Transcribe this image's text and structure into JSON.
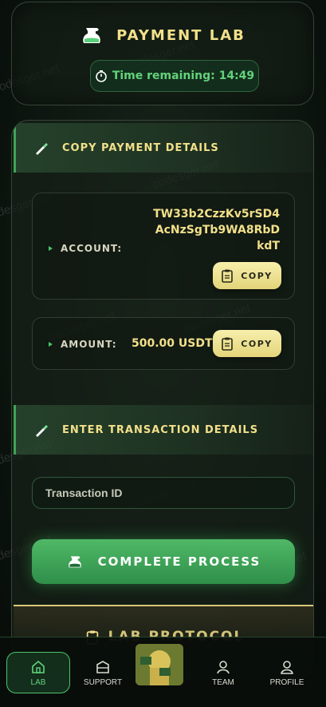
{
  "header": {
    "title": "PAYMENT LAB",
    "timer_text": "Time remaining: 14:49"
  },
  "copy_section": {
    "title": "COPY PAYMENT DETAILS",
    "account_label": "ACCOUNT:",
    "account_value": "TW33b2CzzKv5rSD4AcNzSgTb9WA8RbDkdT",
    "amount_label": "AMOUNT:",
    "amount_value": "500.00 USDT",
    "copy_label": "COPY"
  },
  "transaction_section": {
    "title": "ENTER TRANSACTION DETAILS",
    "input_placeholder": "Transaction ID"
  },
  "complete_button": "COMPLETE PROCESS",
  "protocol_section": {
    "title": "LAB PROTOCOL"
  },
  "nav": {
    "items": [
      {
        "label": "LAB",
        "icon": "home-icon",
        "active": true
      },
      {
        "label": "SUPPORT",
        "icon": "support-icon",
        "active": false
      },
      {
        "label": "TEAM",
        "icon": "team-icon",
        "active": false
      },
      {
        "label": "PROFILE",
        "icon": "profile-icon",
        "active": false
      }
    ]
  },
  "watermark_text": "codesger.net",
  "colors": {
    "accent_gold": "#f2e08a",
    "accent_green": "#4cc46a",
    "button_green": "#3fa45a",
    "copy_button": "#efe494"
  }
}
